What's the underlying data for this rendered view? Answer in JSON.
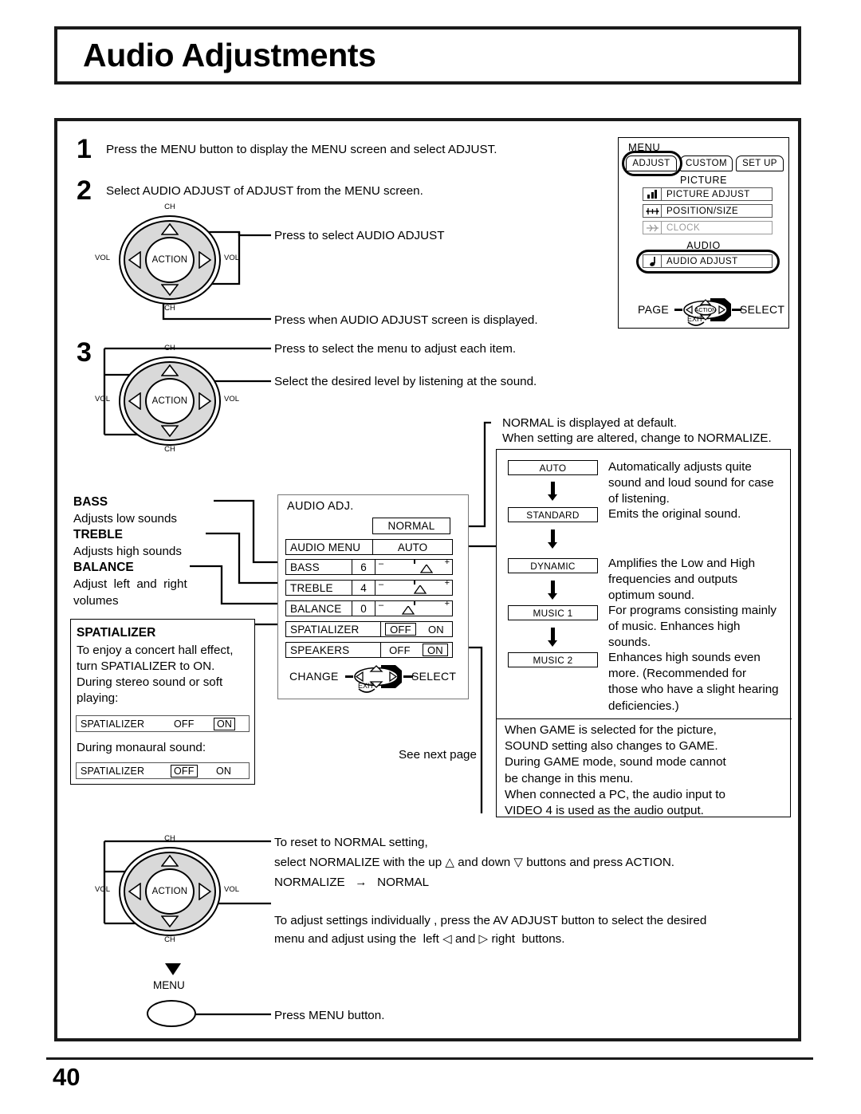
{
  "page": {
    "title": "Audio Adjustments",
    "number": "40"
  },
  "steps": [
    {
      "num": "1",
      "text": "Press the MENU button to display the MENU screen and select ADJUST."
    },
    {
      "num": "2",
      "text": "Select AUDIO ADJUST of ADJUST from the MENU screen."
    },
    {
      "num": "3",
      "text": ""
    }
  ],
  "callouts": {
    "select_audio_adjust": "Press to select AUDIO ADJUST",
    "when_displayed": "Press when AUDIO ADJUST screen is displayed.",
    "select_menu_item": "Press to select the menu to adjust each item.",
    "select_level": "Select the desired level by listening at the sound.",
    "normal_default_line1": "NORMAL is displayed at default.",
    "normal_default_line2": "When setting are altered, change to NORMALIZE.",
    "see_next_page": "See next page"
  },
  "osd_menu": {
    "header": "MENU",
    "tabs": [
      {
        "label": "ADJUST",
        "selected": true
      },
      {
        "label": "CUSTOM",
        "selected": false
      },
      {
        "label": "SET  UP",
        "selected": false
      }
    ],
    "picture_section": "PICTURE",
    "audio_section": "AUDIO",
    "picture_items": [
      {
        "label": "PICTURE  ADJUST",
        "icon": "bars-icon",
        "dimmed": false
      },
      {
        "label": "POSITION/SIZE",
        "icon": "position-size-icon",
        "dimmed": false
      },
      {
        "label": "CLOCK",
        "icon": "clock-icon",
        "dimmed": true
      }
    ],
    "audio_items": [
      {
        "label": "AUDIO  ADJUST",
        "icon": "note-icon",
        "dimmed": false,
        "highlighted": true
      }
    ],
    "nav_left": "PAGE",
    "nav_right": "SELECT",
    "nav_center": "ACTION",
    "nav_exit": "EXIT"
  },
  "audio_adj": {
    "title": "AUDIO ADJ.",
    "normal_chip": "NORMAL",
    "rows": [
      {
        "label": "AUDIO  MENU",
        "type": "value",
        "value": "AUTO"
      },
      {
        "label": "BASS",
        "type": "slider",
        "value": "6",
        "knob_pct": 70
      },
      {
        "label": "TREBLE",
        "type": "slider",
        "value": "4",
        "knob_pct": 63
      },
      {
        "label": "BALANCE",
        "type": "slider",
        "value": "0",
        "knob_pct": 50
      },
      {
        "label": "SPATIALIZER",
        "type": "onoff",
        "options": [
          "OFF",
          "ON"
        ],
        "selected": "OFF"
      },
      {
        "label": "SPEAKERS",
        "type": "onoff",
        "options": [
          "OFF",
          "ON"
        ],
        "selected": "ON"
      }
    ],
    "nav_left": "CHANGE",
    "nav_right": "SELECT",
    "nav_exit": "EXIT"
  },
  "left_descriptions": {
    "bass": {
      "term": "BASS",
      "desc": "Adjusts low sounds"
    },
    "treble": {
      "term": "TREBLE",
      "desc": "Adjusts high sounds"
    },
    "balance": {
      "term": "BALANCE",
      "desc_line1": "Adjust  left  and  right",
      "desc_line2": "volumes"
    },
    "spatializer": {
      "term": "SPATIALIZER",
      "body_line1": "To enjoy a concert hall effect,",
      "body_line2": "turn SPATIALIZER to ON.",
      "body_line3": "During stereo sound or soft",
      "body_line4": "playing:",
      "stereo_osd": {
        "label": "SPATIALIZER",
        "off": "OFF",
        "on": "ON",
        "selected": "ON"
      },
      "mono_caption": "During monaural sound:",
      "mono_osd": {
        "label": "SPATIALIZER",
        "off": "OFF",
        "on": "ON",
        "selected": "OFF"
      }
    }
  },
  "sound_modes": [
    {
      "chip": "AUTO",
      "desc_lines": [
        "Automatically  adjusts  quite",
        "sound and loud sound for case",
        "of listening."
      ]
    },
    {
      "chip": "STANDARD",
      "desc_lines": [
        "Emits the original sound."
      ]
    },
    {
      "chip": "DYNAMIC",
      "desc_lines": [
        "Amplifies  the  Low  and  High",
        "frequencies   and   outputs",
        "optimum sound."
      ]
    },
    {
      "chip": "MUSIC 1",
      "desc_lines": [
        "For programs consisting mainly",
        "of  music.  Enhances  high",
        "sounds."
      ]
    },
    {
      "chip": "MUSIC 2",
      "desc_lines": [
        "Enhances high sounds even",
        "more.  (Recommended  for",
        "those who have a slight hearing",
        "deficiencies.)"
      ]
    }
  ],
  "game_notes": [
    "When  GAME  is  selected  for  the  picture,",
    "SOUND setting also changes to GAME.",
    "During GAME mode, sound mode cannot",
    "be change in this menu.",
    "When connected a PC, the audio input to",
    "VIDEO 4 is used as the audio output."
  ],
  "bottom": {
    "reset_line1": "To reset to NORMAL setting,",
    "reset_line2_a": "select NORMALIZE with the up ",
    "reset_line2_up": "△",
    "reset_line2_b": " and down ",
    "reset_line2_dn": "▽",
    "reset_line2_c": " buttons and press ACTION.",
    "reset_line3": "NORMALIZE   →   NORMAL",
    "adjust_line1": "To adjust settings individually , press the AV ADJUST button to select the desired",
    "adjust_line2_a": "menu and adjust using the  left ",
    "adjust_line2_lf": "◁",
    "adjust_line2_b": " and ",
    "adjust_line2_rt": "▷",
    "adjust_line2_c": " right  buttons.",
    "menu_button_label": "MENU",
    "press_menu": "Press MENU button."
  },
  "dial_labels": {
    "ch": "CH",
    "vol": "VOL",
    "action": "ACTION"
  },
  "colors": {
    "ink": "#000000",
    "dial_gray": "#d9d9d9",
    "osd_border": "#555555",
    "dim_text": "#9a9a9a"
  }
}
